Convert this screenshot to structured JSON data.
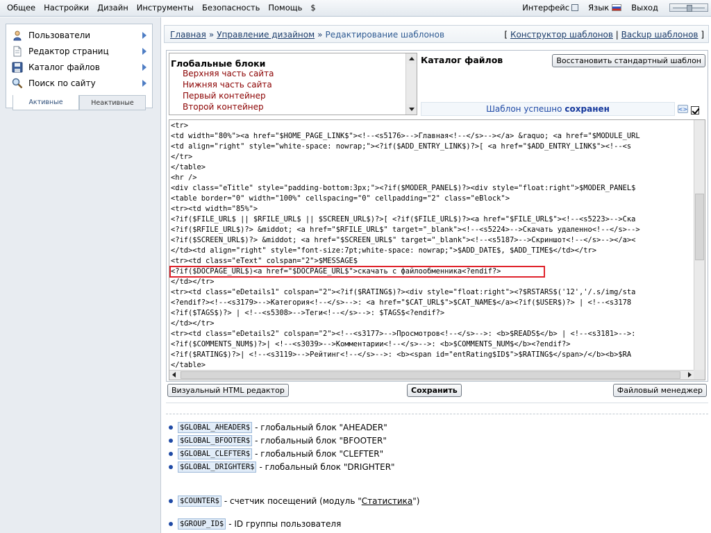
{
  "topmenu": {
    "items": [
      "Общее",
      "Настройки",
      "Дизайн",
      "Инструменты",
      "Безопасность",
      "Помощь",
      "$"
    ],
    "interface_label": "Интерфейс",
    "language_label": "Язык",
    "logout_label": "Выход"
  },
  "sidebar": {
    "items": [
      {
        "label": "Пользователи",
        "icon": "users-icon"
      },
      {
        "label": "Редактор страниц",
        "icon": "page-editor-icon"
      },
      {
        "label": "Каталог файлов",
        "icon": "floppy-disk-icon"
      },
      {
        "label": "Поиск по сайту",
        "icon": "magnifier-icon"
      }
    ],
    "tabs": {
      "active": "Активные",
      "inactive": "Неактивные"
    }
  },
  "breadcrumb": {
    "home": "Главная",
    "sep": "»",
    "design": "Управление дизайном",
    "current": "Редактирование шаблонов",
    "bracket_open": "[",
    "bracket_close": "]",
    "pipe": "|",
    "constructor": "Конструктор шаблонов",
    "backup": "Backup шаблонов"
  },
  "global_blocks": {
    "title": "Глобальные блоки",
    "items": [
      "Верхняя часть сайта",
      "Нижняя часть сайта",
      "Первый контейнер",
      "Второй контейнер"
    ]
  },
  "file_catalog_label": "Каталог файлов",
  "restore_button": "Восстановить стандартный шаблон",
  "saved_message": {
    "text": "Шаблон успешно",
    "bold": "сохранен"
  },
  "code_lines": [
    "<tr>",
    "<td width=\"80%\"><a href=\"$HOME_PAGE_LINK$\"><!--<s5176>-->Главная<!--</s>--></a> &raquo; <a href=\"$MODULE_URL",
    "<td align=\"right\" style=\"white-space: nowrap;\"><?if($ADD_ENTRY_LINK$)?>[ <a href=\"$ADD_ENTRY_LINK$\"><!--<s",
    "</tr>",
    "</table>",
    "<hr />",
    "<div class=\"eTitle\" style=\"padding-bottom:3px;\"><?if($MODER_PANEL$)?><div style=\"float:right\">$MODER_PANEL$",
    "<table border=\"0\" width=\"100%\" cellspacing=\"0\" cellpadding=\"2\" class=\"eBlock\">",
    "<tr><td width=\"85%\">",
    "<?if($FILE_URL$ || $RFILE_URL$ || $SCREEN_URL$)?>[ <?if($FILE_URL$)?><a href=\"$FILE_URL$\"><!--<s5223>-->Ска",
    "<?if($RFILE_URL$)?> &middot; <a href=\"$RFILE_URL$\" target=\"_blank\"><!--<s5224>-->Скачать удаленно<!--</s>-->",
    "<?if($SCREEN_URL$)?> &middot; <a href=\"$SCREEN_URL$\" target=\"_blank\"><!--<s5187>-->Скриншот<!--</s>--></a><",
    "</td><td align=\"right\" style=\"font-size:7pt;white-space: nowrap;\">$ADD_DATE$, $ADD_TIME$</td></tr>",
    "<tr><td class=\"eText\" colspan=\"2\">$MESSAGE$",
    "<?if($DOCPAGE_URL$)<a href=\"$DOCPAGE_URL$\">скачать с файлообменника<?endif?>",
    "</td></tr>",
    "<tr><td class=\"eDetails1\" colspan=\"2\"><?if($RATING$)?><div style=\"float:right\"><?$RSTARS$('12','/.s/img/sta",
    "<?endif?><!--<s3179>-->Категория<!--</s>-->: <a href=\"$CAT_URL$\">$CAT_NAME$</a><?if($USER$)?> | <!--<s3178",
    "<?if($TAGS$)?> | <!--<s5308>-->Теги<!--</s>-->: $TAGS$<?endif?>",
    "</td></tr>",
    "<tr><td class=\"eDetails2\" colspan=\"2\"><!--<s3177>-->Просмотров<!--</s>-->: <b>$READS$</b> | <!--<s3181>-->:",
    "<?if($COMMENTS_NUM$)?>| <!--<s3039>-->Комментарии<!--</s>-->: <b>$COMMENTS_NUM$</b><?endif?>",
    "<?if($RATING$)?>| <!--<s3119>-->Рейтинг<!--</s>-->: <b><span id=\"entRating$ID$\">$RATING$</span>/</b><b>$RA",
    "</table>"
  ],
  "buttons": {
    "visual": "Визуальный HTML редактор",
    "save": "Сохранить",
    "file_manager": "Файловый менеджер"
  },
  "variables": [
    {
      "var": "$GLOBAL_AHEADER$",
      "desc": " - глобальный блок \"AHEADER\""
    },
    {
      "var": "$GLOBAL_BFOOTER$",
      "desc": " - глобальный блок \"BFOOTER\""
    },
    {
      "var": "$GLOBAL_CLEFTER$",
      "desc": " - глобальный блок \"CLEFTER\""
    },
    {
      "var": "$GLOBAL_DRIGHTER$",
      "desc": " - глобальный блок \"DRIGHTER\""
    },
    {
      "var": "$COUNTER$",
      "desc_pre": " - счетчик посещений (модуль \"",
      "link": "Статистика",
      "desc_post": "\")"
    },
    {
      "var": "$GROUP_ID$",
      "desc": " - ID группы пользователя"
    }
  ]
}
